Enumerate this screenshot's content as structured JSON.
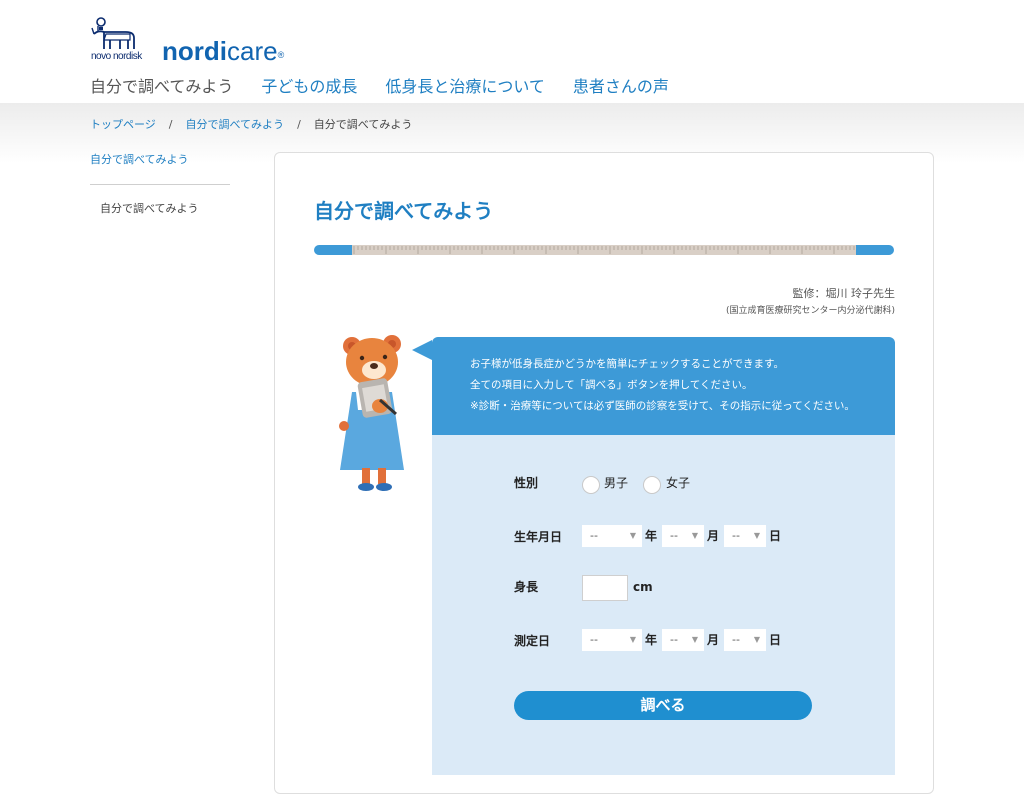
{
  "header": {
    "company": "novo nordisk",
    "brand_bold": "nordi",
    "brand_rest": "care",
    "brand_mark": "®"
  },
  "nav": [
    {
      "label": "自分で調べてみよう"
    },
    {
      "label": "子どもの成長"
    },
    {
      "label": "低身長と治療について"
    },
    {
      "label": "患者さんの声"
    }
  ],
  "breadcrumb": {
    "items": [
      "トップページ",
      "自分で調べてみよう"
    ],
    "separator": "/",
    "current": "自分で調べてみよう"
  },
  "sidebar": {
    "heading": "自分で調べてみよう",
    "item": "自分で調べてみよう"
  },
  "main": {
    "title": "自分で調べてみよう",
    "supervisor": "監修：堀川 玲子先生",
    "institution": "(国立成育医療研究センター内分泌代謝科)",
    "message": [
      "お子様が低身長症かどうかを簡単にチェックすることができます。",
      "全ての項目に入力して「調べる」ボタンを押してください。",
      "※診断・治療等については必ず医師の診察を受けて、その指示に従ってください。"
    ]
  },
  "form": {
    "gender_label": "性別",
    "gender_options": [
      "男子",
      "女子"
    ],
    "birthdate_label": "生年月日",
    "height_label": "身長",
    "height_unit": "cm",
    "measure_label": "測定日",
    "select_placeholder": "--",
    "unit_year": "年",
    "unit_month": "月",
    "unit_day": "日",
    "submit_label": "調べる"
  },
  "colors": {
    "brand_blue": "#1164b0",
    "link_blue": "#1f7fc2",
    "panel_blue": "#3d9ad7",
    "form_bg": "#dbeaf7",
    "button_blue": "#1f8fd0"
  }
}
